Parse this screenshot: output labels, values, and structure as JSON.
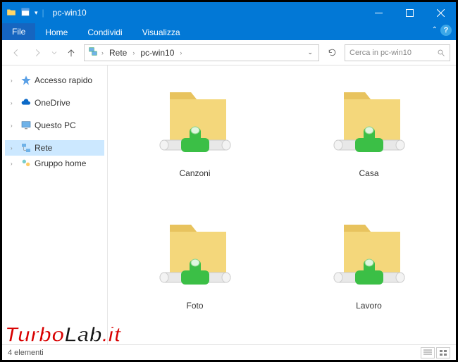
{
  "window": {
    "title": "pc-win10"
  },
  "ribbon": {
    "file": "File",
    "tabs": [
      "Home",
      "Condividi",
      "Visualizza"
    ]
  },
  "breadcrumb": {
    "segments": [
      "Rete",
      "pc-win10"
    ]
  },
  "search": {
    "placeholder": "Cerca in pc-win10"
  },
  "nav": {
    "quick": "Accesso rapido",
    "onedrive": "OneDrive",
    "thispc": "Questo PC",
    "network": "Rete",
    "homegroup": "Gruppo home"
  },
  "items": [
    {
      "label": "Canzoni"
    },
    {
      "label": "Casa"
    },
    {
      "label": "Foto"
    },
    {
      "label": "Lavoro"
    }
  ],
  "status": {
    "count": "4 elementi"
  },
  "watermark": {
    "part1": "Turbo",
    "part2": "Lab",
    "part3": ".it"
  }
}
